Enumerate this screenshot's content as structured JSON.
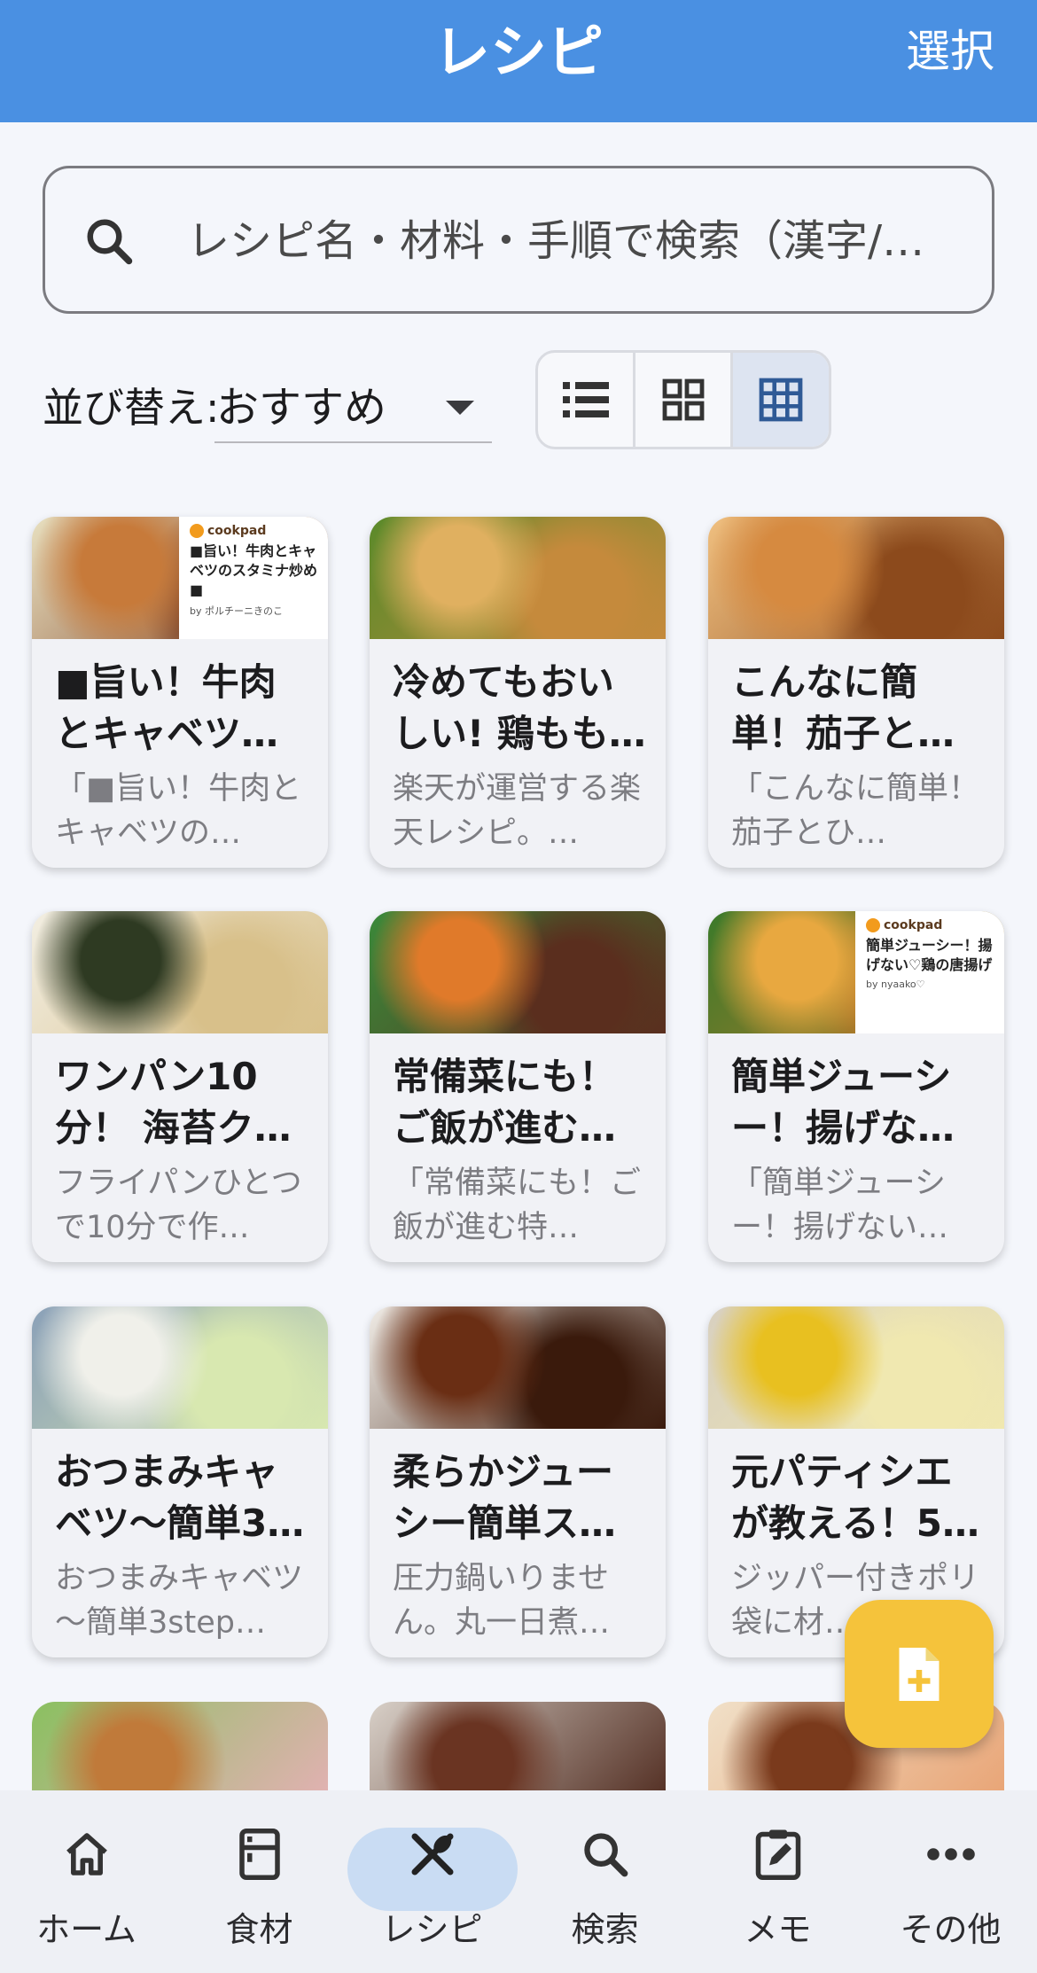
{
  "header": {
    "title": "レシピ",
    "select_label": "選択"
  },
  "search": {
    "placeholder": "レシピ名・材料・手順で検索（漢字/…"
  },
  "sort": {
    "label": "並び替え:",
    "value": "おすすめ"
  },
  "view_modes": [
    {
      "name": "list",
      "icon": "list-icon",
      "selected": false
    },
    {
      "name": "grid-2",
      "icon": "grid-2x2-icon",
      "selected": false
    },
    {
      "name": "grid-3",
      "icon": "grid-3x3-icon",
      "selected": true
    }
  ],
  "recipes": [
    {
      "title": "■旨い！牛肉とキャベツ…",
      "desc": "「■旨い！牛肉とキャベツの…",
      "overlay": {
        "brand": "cookpad",
        "text": "■旨い！牛肉とキャベツのスタミナ炒め■",
        "by": "by ポルチーニきのこ"
      },
      "colors": [
        "#7a3a1c",
        "#c77a3a",
        "#e8e0c0"
      ]
    },
    {
      "title": "冷めてもおいしい! 鶏もも…",
      "desc": "楽天が運営する楽天レシピ。…",
      "colors": [
        "#c58a3c",
        "#e0b060",
        "#5a8a2a"
      ]
    },
    {
      "title": "こんなに簡単！茄子と…",
      "desc": "「こんなに簡単！茄子とひ…",
      "colors": [
        "#8c4a1c",
        "#d68a40",
        "#f0c080"
      ]
    },
    {
      "title": "ワンパン10分！ 海苔ク…",
      "desc": "フライパンひとつで10分で作…",
      "colors": [
        "#d8c08a",
        "#2e3a22",
        "#f2eee2"
      ]
    },
    {
      "title": "常備菜にも！ご飯が進む…",
      "desc": "「常備菜にも！ご飯が進む特…",
      "colors": [
        "#5a2e1e",
        "#e07a2a",
        "#3a8a3a"
      ]
    },
    {
      "title": "簡単ジューシー！揚げな…",
      "desc": "「簡単ジューシー！揚げない…",
      "overlay": {
        "brand": "cookpad",
        "text": "簡単ジューシー！揚げない♡鶏の唐揚げ",
        "by": "by nyaako♡"
      },
      "colors": [
        "#c07a2a",
        "#e8a840",
        "#3a7a2a"
      ]
    },
    {
      "title": "おつまみキャベツ～簡単3…",
      "desc": "おつまみキャベツ～簡単3step…",
      "colors": [
        "#d8e8b0",
        "#f0f0ea",
        "#8aa0b8"
      ]
    },
    {
      "title": "柔らかジューシー簡単ス…",
      "desc": "圧力鍋いりません。丸一日煮…",
      "colors": [
        "#3a1a0c",
        "#6a2e14",
        "#f0ece6"
      ]
    },
    {
      "title": "元パティシエが教える！5…",
      "desc": "ジッパー付きポリ袋に材…",
      "colors": [
        "#f0e8b0",
        "#e8c020",
        "#d8d0c0"
      ]
    }
  ],
  "partial_row_colors": [
    [
      "#e8b0b8",
      "#c07a3a",
      "#8ac060"
    ],
    [
      "#4a2418",
      "#6a3422",
      "#d8d0c8"
    ],
    [
      "#e8a070",
      "#7a3a1c",
      "#f0e0c8"
    ]
  ],
  "fab": {
    "icon": "add-note-icon"
  },
  "nav": [
    {
      "label": "ホーム",
      "icon": "home-icon"
    },
    {
      "label": "食材",
      "icon": "fridge-icon"
    },
    {
      "label": "レシピ",
      "icon": "utensils-icon",
      "active": true
    },
    {
      "label": "検索",
      "icon": "search-icon"
    },
    {
      "label": "メモ",
      "icon": "memo-icon"
    },
    {
      "label": "その他",
      "icon": "more-icon"
    }
  ],
  "colors": {
    "header": "#4a90e2",
    "fab": "#f5c33b",
    "active_pill": "#c9dcf3",
    "view_selected": "#dde4f1"
  }
}
